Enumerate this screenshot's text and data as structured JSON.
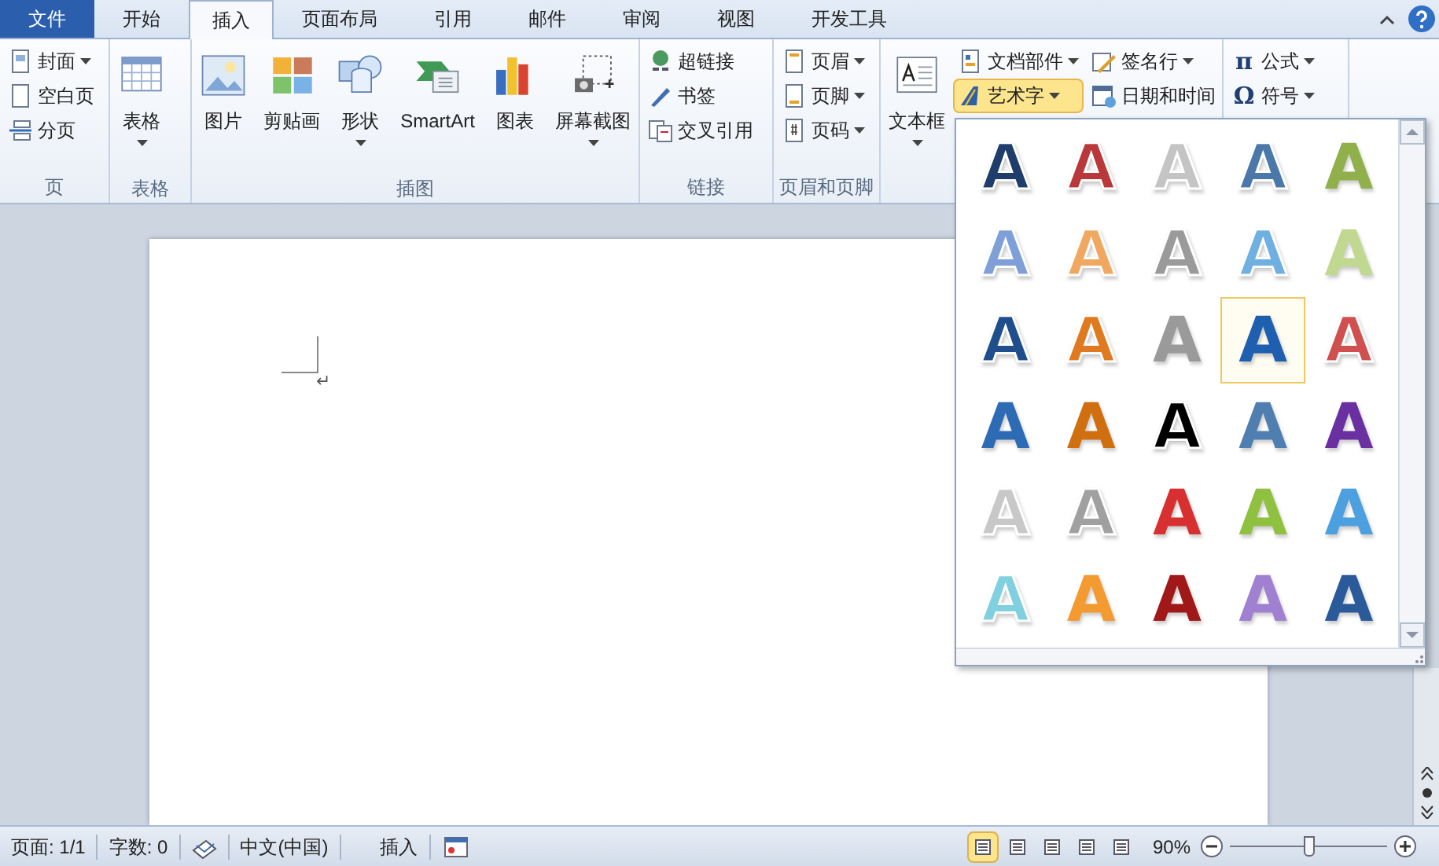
{
  "tabs": [
    {
      "label": "文件",
      "kind": "file",
      "selected": false
    },
    {
      "label": "开始",
      "kind": "tab",
      "selected": false
    },
    {
      "label": "插入",
      "kind": "tab",
      "selected": true
    },
    {
      "label": "页面布局",
      "kind": "tab",
      "selected": false
    },
    {
      "label": "引用",
      "kind": "tab",
      "selected": false
    },
    {
      "label": "邮件",
      "kind": "tab",
      "selected": false
    },
    {
      "label": "审阅",
      "kind": "tab",
      "selected": false
    },
    {
      "label": "视图",
      "kind": "tab",
      "selected": false
    },
    {
      "label": "开发工具",
      "kind": "tab",
      "selected": false
    }
  ],
  "ribbon_groups": [
    {
      "label": "页",
      "columns": [
        [
          {
            "label": "封面",
            "kind": "small",
            "dropdown": true,
            "selected": false
          },
          {
            "label": "空白页",
            "kind": "small",
            "dropdown": false,
            "selected": false
          },
          {
            "label": "分页",
            "kind": "small",
            "dropdown": false,
            "selected": false
          }
        ]
      ]
    },
    {
      "label": "表格",
      "columns": [
        [
          {
            "label": "表格",
            "kind": "large",
            "dropdown": true,
            "selected": false
          }
        ]
      ]
    },
    {
      "label": "插图",
      "columns": [
        [
          {
            "label": "图片",
            "kind": "large",
            "dropdown": false,
            "selected": false
          }
        ],
        [
          {
            "label": "剪贴画",
            "kind": "large",
            "dropdown": false,
            "selected": false
          }
        ],
        [
          {
            "label": "形状",
            "kind": "large",
            "dropdown": true,
            "selected": false
          }
        ],
        [
          {
            "label": "SmartArt",
            "kind": "large",
            "dropdown": false,
            "selected": false
          }
        ],
        [
          {
            "label": "图表",
            "kind": "large",
            "dropdown": false,
            "selected": false
          }
        ],
        [
          {
            "label": "屏幕截图",
            "kind": "large",
            "dropdown": true,
            "selected": false
          }
        ]
      ]
    },
    {
      "label": "链接",
      "columns": [
        [
          {
            "label": "超链接",
            "kind": "small",
            "dropdown": false,
            "selected": false
          },
          {
            "label": "书签",
            "kind": "small",
            "dropdown": false,
            "selected": false
          },
          {
            "label": "交叉引用",
            "kind": "small",
            "dropdown": false,
            "selected": false
          }
        ]
      ]
    },
    {
      "label": "页眉和页脚",
      "columns": [
        [
          {
            "label": "页眉",
            "kind": "small",
            "dropdown": true,
            "selected": false
          },
          {
            "label": "页脚",
            "kind": "small",
            "dropdown": true,
            "selected": false
          },
          {
            "label": "页码",
            "kind": "small",
            "dropdown": true,
            "selected": false
          }
        ]
      ]
    },
    {
      "columns": [
        [
          {
            "label": "文本框",
            "kind": "large",
            "dropdown": true,
            "selected": false
          }
        ],
        [
          {
            "label": "文档部件",
            "kind": "small",
            "dropdown": true,
            "selected": false
          },
          {
            "label": "艺术字",
            "kind": "small",
            "dropdown": true,
            "selected": true
          }
        ],
        [
          {
            "label": "签名行",
            "kind": "small",
            "dropdown": true,
            "selected": false
          },
          {
            "label": "日期和时间",
            "kind": "small",
            "dropdown": false,
            "selected": false
          }
        ]
      ]
    },
    {
      "columns": [
        [
          {
            "label": "公式",
            "kind": "symbol",
            "symbol": "π",
            "dropdown": true,
            "selected": false
          },
          {
            "label": "符号",
            "kind": "symbol",
            "symbol": "Ω",
            "dropdown": true,
            "selected": false
          }
        ]
      ]
    }
  ],
  "document": {
    "paragraph_mark": "↵"
  },
  "wordart_gallery": {
    "items": [
      {
        "text": "A",
        "kind": "outline",
        "color": "#1f3d6b",
        "selected": false
      },
      {
        "text": "A",
        "kind": "outline",
        "color": "#b9383a",
        "selected": false
      },
      {
        "text": "A",
        "kind": "outline",
        "color": "#c4c4c4",
        "selected": false
      },
      {
        "text": "A",
        "kind": "outline",
        "color": "#4a78a8",
        "selected": false
      },
      {
        "text": "A",
        "kind": "solid",
        "color": "#8fb04a",
        "selected": false
      },
      {
        "text": "A",
        "kind": "outline",
        "color": "#7f9fd8",
        "selected": false
      },
      {
        "text": "A",
        "kind": "outline",
        "color": "#f0a860",
        "selected": false
      },
      {
        "text": "A",
        "kind": "outline",
        "color": "#9a9a9a",
        "selected": false
      },
      {
        "text": "A",
        "kind": "outline",
        "color": "#6fb0e0",
        "selected": false
      },
      {
        "text": "A",
        "kind": "solid",
        "color": "#c0d890",
        "selected": false
      },
      {
        "text": "A",
        "kind": "outline",
        "color": "#1f4e8c",
        "selected": false
      },
      {
        "text": "A",
        "kind": "outline",
        "color": "#e07a20",
        "selected": false
      },
      {
        "text": "A",
        "kind": "solid",
        "color": "#9a9a9a",
        "selected": false
      },
      {
        "text": "A",
        "kind": "solid",
        "color": "#1f5fb0",
        "selected": true
      },
      {
        "text": "A",
        "kind": "outline",
        "color": "#d05050",
        "selected": false
      },
      {
        "text": "A",
        "kind": "solid",
        "color": "#2e6bb5",
        "selected": false
      },
      {
        "text": "A",
        "kind": "solid",
        "color": "#d06f10",
        "selected": false
      },
      {
        "text": "A",
        "kind": "outline",
        "color": "#000000",
        "selected": false
      },
      {
        "text": "A",
        "kind": "solid",
        "color": "#4f7fb0",
        "selected": false
      },
      {
        "text": "A",
        "kind": "solid",
        "color": "#6a2fa0",
        "selected": false
      },
      {
        "text": "A",
        "kind": "outline",
        "color": "#c8c8c8",
        "selected": false
      },
      {
        "text": "A",
        "kind": "outline",
        "color": "#a0a0a0",
        "selected": false
      },
      {
        "text": "A",
        "kind": "solid",
        "color": "#d83030",
        "selected": false
      },
      {
        "text": "A",
        "kind": "solid",
        "color": "#90c040",
        "selected": false
      },
      {
        "text": "A",
        "kind": "solid",
        "color": "#4ca0e0",
        "selected": false
      },
      {
        "text": "A",
        "kind": "outline",
        "color": "#80d0e0",
        "selected": false
      },
      {
        "text": "A",
        "kind": "solid",
        "color": "#f39a30",
        "selected": false
      },
      {
        "text": "A",
        "kind": "solid",
        "color": "#a01818",
        "selected": false
      },
      {
        "text": "A",
        "kind": "solid",
        "color": "#a080d0",
        "selected": false
      },
      {
        "text": "A",
        "kind": "solid",
        "color": "#2a5a9a",
        "selected": false
      }
    ]
  },
  "status_bar": {
    "items": [
      "页面: 1/1",
      "字数: 0",
      "中文(中国)",
      "插入"
    ],
    "view_buttons": [
      {
        "selected": true
      },
      {
        "selected": false
      },
      {
        "selected": false
      },
      {
        "selected": false
      },
      {
        "selected": false
      }
    ],
    "zoom": {
      "reading": "90%",
      "level": 0.5
    }
  }
}
